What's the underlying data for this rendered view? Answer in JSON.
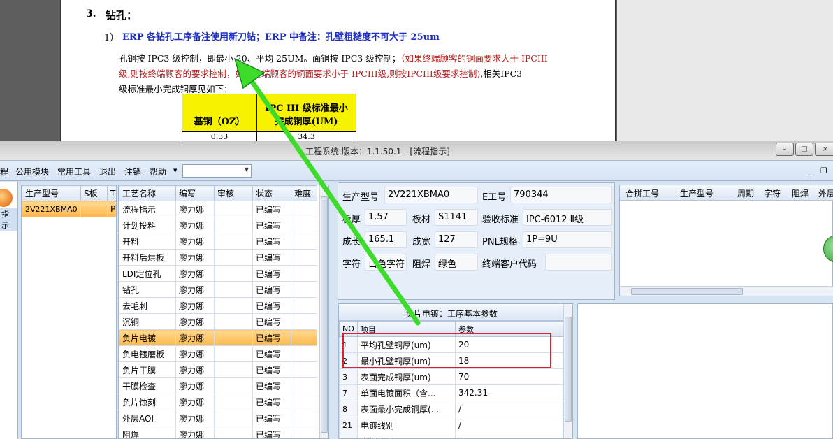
{
  "document": {
    "heading_num": "3.",
    "heading": "钻孔：",
    "item_num": "1）",
    "item_blue": "ERP 各钻孔工序备注使用新刀钻；ERP 中备注：孔壁粗糙度不可大于 25um",
    "para1_black": "孔铜按 IPC3 级控制，即最小 20、平均 25UM。面铜按 IPC3 级控制；",
    "para1_red": "（如果终端顾客的铜面要求大于 IPCIII",
    "para2_red": "级,则按终端顾客的要求控制，如果终端顾客的铜面要求小于 IPCIII级,则按IPCIII级要求控制)",
    "para2_black": ",相关IPC3",
    "para3": "级标准最小完成铜厚见如下：",
    "table": {
      "col1_header": "基铜（OZ）",
      "col2_header_line1": "IPC III 级标准最小",
      "col2_header_line2": "完成铜厚(UM)",
      "row1": [
        "0.33",
        "34.3"
      ]
    }
  },
  "window": {
    "title": "工程系统  版本：1.1.50.1 - [流程指示]",
    "minimize": "–",
    "maximize": "□",
    "close": "×"
  },
  "menu": {
    "items": [
      "程",
      "公用模块",
      "常用工具",
      "退出",
      "注销",
      "帮助"
    ],
    "dropdown_arrow": "▼",
    "mdi_min": "_",
    "mdi_restore": "❐"
  },
  "left_strip": {
    "label": "指示"
  },
  "product_grid": {
    "headers": [
      "生产型号",
      "S板",
      "T"
    ],
    "rows": [
      [
        "2V221XBMA0",
        "",
        "P"
      ]
    ]
  },
  "process_grid": {
    "headers": [
      "工艺名称",
      "编写",
      "审核",
      "状态",
      "难度"
    ],
    "rows": [
      [
        "流程指示",
        "廖力娜",
        "",
        "已编写",
        ""
      ],
      [
        "计划投料",
        "廖力娜",
        "",
        "已编写",
        ""
      ],
      [
        "开料",
        "廖力娜",
        "",
        "已编写",
        ""
      ],
      [
        "开料后烘板",
        "廖力娜",
        "",
        "已编写",
        ""
      ],
      [
        "LDI定位孔",
        "廖力娜",
        "",
        "已编写",
        ""
      ],
      [
        "钻孔",
        "廖力娜",
        "",
        "已编写",
        ""
      ],
      [
        "去毛刺",
        "廖力娜",
        "",
        "已编写",
        ""
      ],
      [
        "沉铜",
        "廖力娜",
        "",
        "已编写",
        ""
      ],
      [
        "负片电镀",
        "廖力娜",
        "",
        "已编写",
        ""
      ],
      [
        "负电镀磨板",
        "廖力娜",
        "",
        "已编写",
        ""
      ],
      [
        "负片干膜",
        "廖力娜",
        "",
        "已编写",
        ""
      ],
      [
        "干膜检查",
        "廖力娜",
        "",
        "已编写",
        ""
      ],
      [
        "负片蚀刻",
        "廖力娜",
        "",
        "已编写",
        ""
      ],
      [
        "外层AOI",
        "廖力娜",
        "",
        "已编写",
        ""
      ],
      [
        "阻焊",
        "廖力娜",
        "",
        "已编写",
        ""
      ]
    ],
    "selected_index": 8
  },
  "info": {
    "model_label": "生产型号",
    "model": "2V221XBMA0",
    "e_label": "E工号",
    "e_value": "790344",
    "thick_label": "板厚",
    "thick": "1.57",
    "material_label": "板材",
    "material": "S1141",
    "accept_label": "验收标准",
    "accept": "IPC-6012 Ⅱ级",
    "len_label": "成长",
    "len": "165.1",
    "width_label": "成宽",
    "width": "127",
    "pnl_label": "PNL规格",
    "pnl": "1P=9U",
    "char_label": "字符",
    "char": "白色字符",
    "mask_label": "阻焊",
    "mask": "绿色",
    "customer_label": "终端客户代码",
    "customer": ""
  },
  "pin_grid": {
    "headers": [
      "合拼工号",
      "生产型号",
      "周期",
      "字符",
      "阻焊",
      "外层"
    ]
  },
  "params": {
    "title": "负片电镀：工序基本参数",
    "headers": [
      "NO",
      "项目",
      "参数"
    ],
    "rows": [
      [
        "1",
        "平均孔壁铜厚(um)",
        "20"
      ],
      [
        "2",
        "最小孔壁铜厚(um)",
        "18"
      ],
      [
        "3",
        "表面完成铜厚(um)",
        "70"
      ],
      [
        "7",
        "单面电镀面积（含...",
        "342.31"
      ],
      [
        "8",
        "表面最小完成铜厚(...",
        "/"
      ],
      [
        "21",
        "电镀线别",
        "/"
      ],
      [
        "",
        "电镀时间",
        "/"
      ]
    ]
  },
  "colors": {
    "selection": "#ffb84c",
    "annotation_arrow": "#3ddc2a",
    "annotation_box": "#e0202a",
    "doc_table_header": "#f7f200"
  }
}
